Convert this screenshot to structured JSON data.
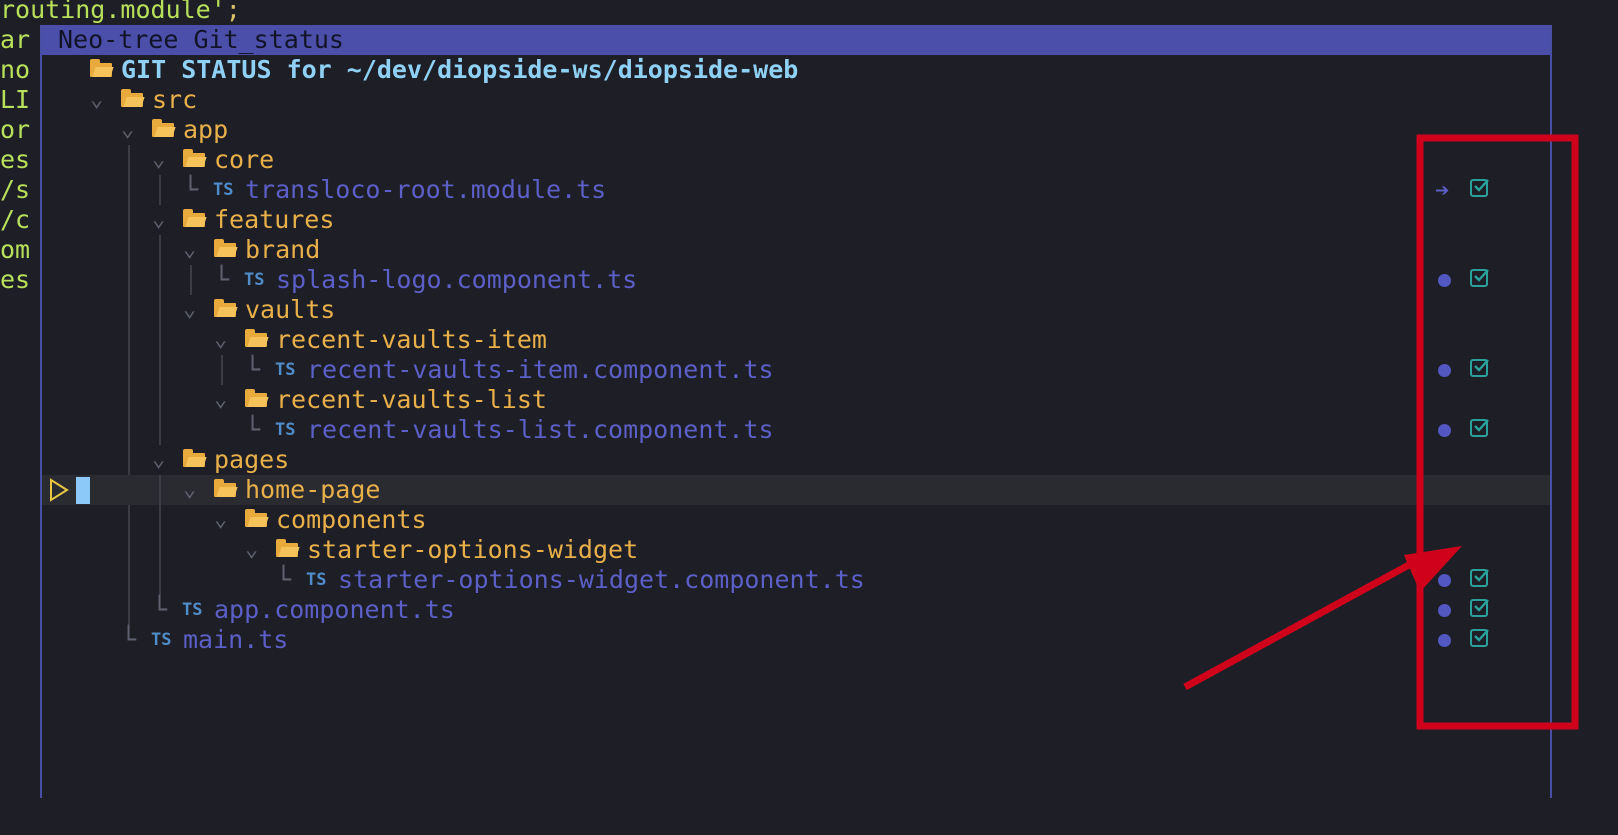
{
  "editor_bg_lines": [
    {
      "text": "routing.module",
      "quote": "'",
      "semi": ";"
    },
    {
      "text": "ar"
    },
    {
      "text": "no"
    },
    {
      "text": "LI"
    },
    {
      "text": "or"
    },
    {
      "text": "es"
    },
    {
      "text": "/s"
    },
    {
      "text": "/c"
    },
    {
      "text": "om"
    },
    {
      "text": "es"
    }
  ],
  "window": {
    "title": "Neo-tree Git_status"
  },
  "tree": {
    "root_label": "GIT STATUS for ~/dev/diopside-ws/diopside-web",
    "nodes": [
      {
        "label": "src"
      },
      {
        "label": "app"
      },
      {
        "label": "core"
      },
      {
        "label": "transloco-root.module.ts",
        "status": "renamed"
      },
      {
        "label": "features"
      },
      {
        "label": "brand"
      },
      {
        "label": "splash-logo.component.ts",
        "status": "modified"
      },
      {
        "label": "vaults"
      },
      {
        "label": "recent-vaults-item"
      },
      {
        "label": "recent-vaults-item.component.ts",
        "status": "modified"
      },
      {
        "label": "recent-vaults-list"
      },
      {
        "label": "recent-vaults-list.component.ts",
        "status": "modified"
      },
      {
        "label": "pages"
      },
      {
        "label": "home-page"
      },
      {
        "label": "components"
      },
      {
        "label": "starter-options-widget"
      },
      {
        "label": "starter-options-widget.component.ts",
        "status": "modified"
      },
      {
        "label": "app.component.ts",
        "status": "modified"
      },
      {
        "label": "main.ts",
        "status": "modified"
      }
    ],
    "ts_icon_text": "TS",
    "elbow_glyph": "└"
  },
  "colors": {
    "titlebar": "#4b4faa",
    "folder": "#e9b04a",
    "file": "#5b5fc7",
    "staged_check": "#2aa19a",
    "annotation": "#d0021b"
  },
  "icons": {
    "renamed": "arrow-right-icon",
    "modified": "dot-icon",
    "staged": "checkbox-checked-icon",
    "folder": "folder-open-icon",
    "file": "typescript-file-icon"
  }
}
